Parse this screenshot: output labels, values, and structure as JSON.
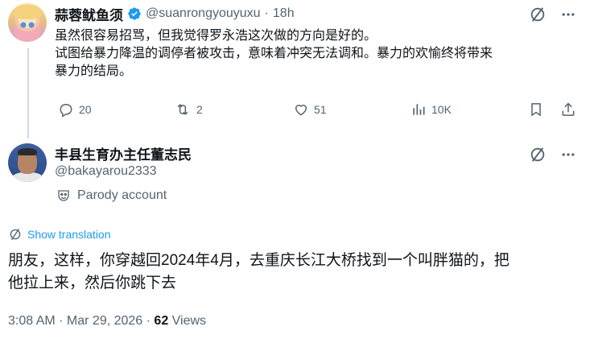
{
  "parent_tweet": {
    "display_name": "蒜蓉鱿鱼须",
    "handle": "@suanrongyouyuxu",
    "separator": "·",
    "time": "18h",
    "body_lines": [
      "虽然很容易招骂，但我觉得罗永浩这次做的方向是好的。",
      "试图给暴力降温的调停者被攻击，意味着冲突无法调和。暴力的欢愉终将带来",
      "暴力的结局。"
    ],
    "stats": {
      "replies": "20",
      "reposts": "2",
      "likes": "51",
      "views": "10K"
    },
    "verified_color": "#1d9bf0"
  },
  "main_tweet": {
    "display_name": "丰县生育办主任董志民",
    "handle": "@bakayarou2333",
    "parody_label": "Parody account",
    "translate_label": "Show translation",
    "body_lines": [
      "朋友，这样，你穿越回2024年4月，去重庆长江大桥找到一个叫胖猫的，把",
      "他拉上来，然后你跳下去"
    ],
    "timestamp": "3:08 AM · Mar 29, 2026 · ",
    "views_count": "62",
    "views_label": " Views"
  },
  "icons": {
    "grok": "grok-icon",
    "more": "more-icon",
    "reply": "reply-icon",
    "repost": "repost-icon",
    "like": "like-icon",
    "views": "views-icon",
    "bookmark": "bookmark-icon",
    "share": "share-icon",
    "parody": "parody-mask-icon",
    "translate": "translate-icon"
  },
  "colors": {
    "accent": "#1d9bf0",
    "muted": "#536471",
    "text": "#0f1419",
    "divider": "#cfd9de"
  }
}
